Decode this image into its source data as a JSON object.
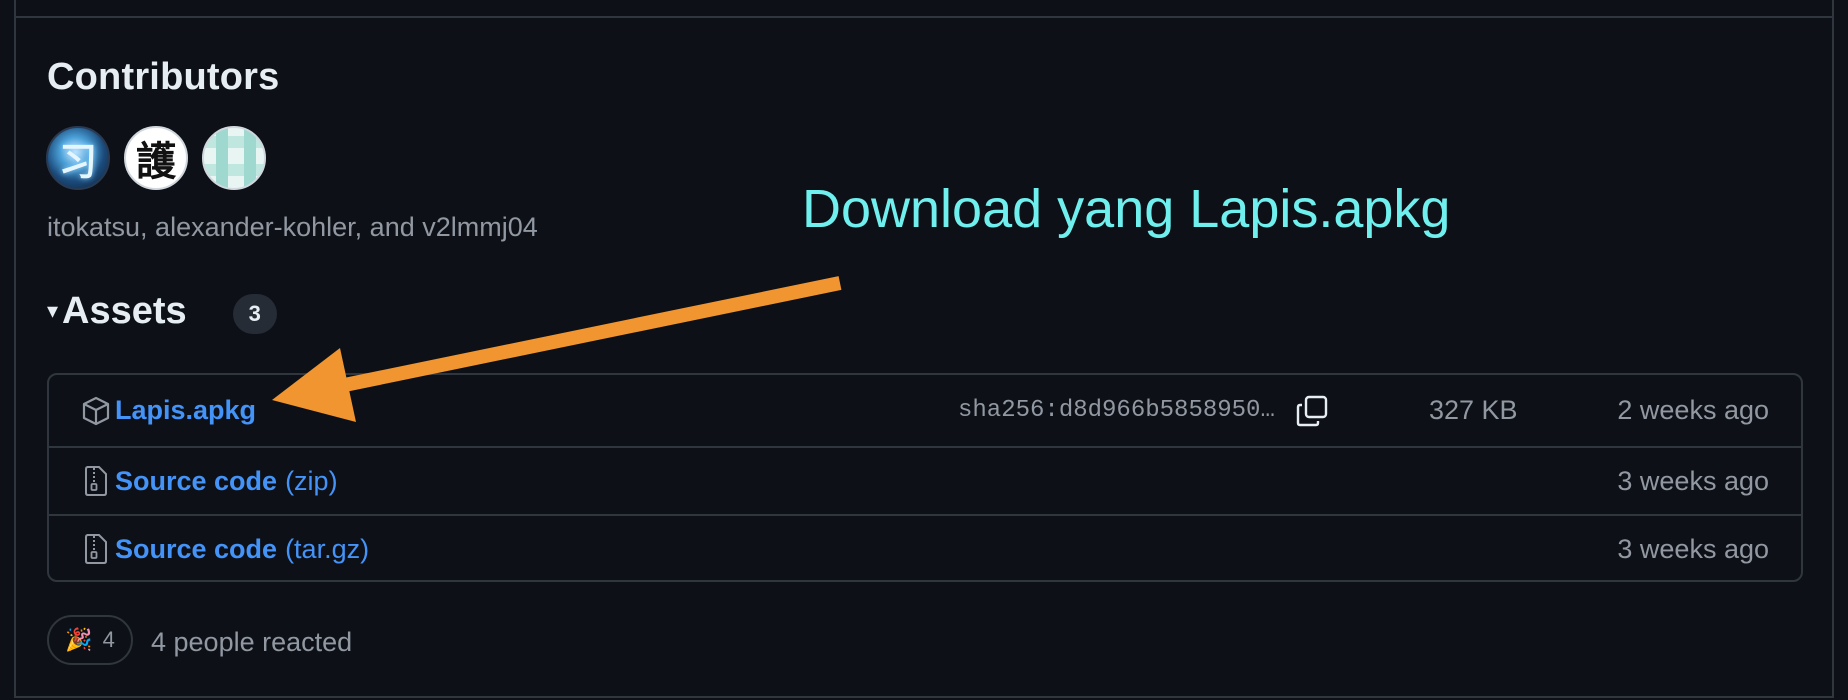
{
  "contributors": {
    "title": "Contributors",
    "avatar_1_glyph": "习",
    "avatar_2_glyph": "護",
    "names": "itokatsu, alexander-kohler, and v2lmmj04"
  },
  "assets": {
    "caret": "▾",
    "title": "Assets",
    "count": "3",
    "rows": [
      {
        "icon": "package-icon",
        "name": "Lapis.apkg",
        "ext": "",
        "sha": "sha256:d8d966b5858950…",
        "size": "327 KB",
        "date": "2 weeks ago"
      },
      {
        "icon": "file-zip-icon",
        "name": "Source code",
        "ext": "(zip)",
        "date": "3 weeks ago"
      },
      {
        "icon": "file-zip-icon",
        "name": "Source code",
        "ext": "(tar.gz)",
        "date": "3 weeks ago"
      }
    ]
  },
  "reactions": {
    "emoji": "🎉",
    "count": "4",
    "summary": "4 people reacted"
  },
  "annotation": {
    "text": "Download yang Lapis.apkg",
    "text_color": "#6ff0ee",
    "arrow_color": "#f0952f"
  },
  "colors": {
    "background": "#0d1117",
    "border": "#30363d",
    "link": "#4493f8",
    "muted": "#9198a1"
  }
}
